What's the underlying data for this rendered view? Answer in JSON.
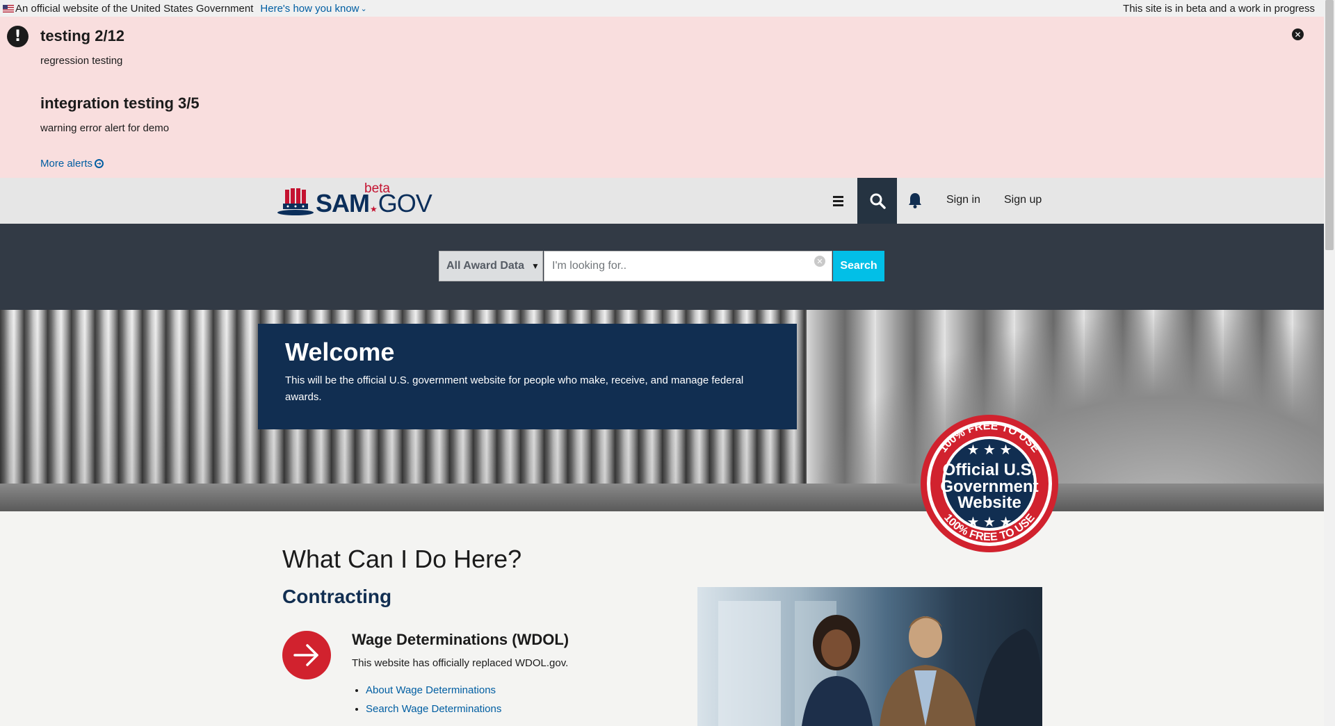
{
  "gov_banner": {
    "official_text": "An official website of the United States Government",
    "how_link": "Here's how you know",
    "beta_text": "This site is in beta and a work in progress"
  },
  "alerts": {
    "items": [
      {
        "title": "testing 2/12",
        "body": "regression testing"
      },
      {
        "title": "integration testing 3/5",
        "body": "warning error alert for demo"
      }
    ],
    "more_link": "More alerts"
  },
  "header": {
    "logo": {
      "sam": "SAM",
      "gov": "GOV",
      "beta": "beta"
    },
    "sign_in": "Sign in",
    "sign_up": "Sign up"
  },
  "search": {
    "domain": "All Award Data",
    "placeholder": "I'm looking for..",
    "button": "Search"
  },
  "hero": {
    "title": "Welcome",
    "text": "This will be the official U.S. government website for people who make, receive, and manage federal awards."
  },
  "badge": {
    "line1": "Official U.S.",
    "line2": "Government",
    "line3": "Website",
    "ring": "100% FREE TO USE"
  },
  "content": {
    "title": "What Can I Do Here?",
    "subtitle": "Contracting",
    "card": {
      "title": "Wage Determinations (WDOL)",
      "text": "This website has officially replaced WDOL.gov.",
      "links": [
        "About Wage Determinations",
        "Search Wage Determinations"
      ]
    }
  },
  "colors": {
    "alert_bg": "#f9dede",
    "header_bg": "#e6e6e6",
    "search_band": "#323a45",
    "navy": "#112e51",
    "accent_cyan": "#02bfe7",
    "red": "#d1222e"
  }
}
